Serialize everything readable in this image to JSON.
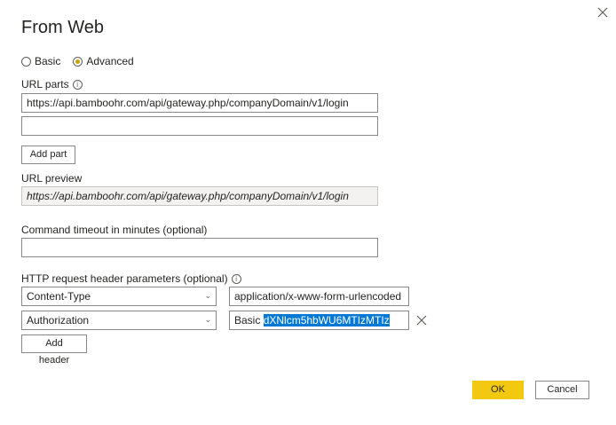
{
  "dialog": {
    "title": "From Web",
    "close_icon": "close-icon"
  },
  "mode": {
    "basic_label": "Basic",
    "advanced_label": "Advanced",
    "selected": "Advanced"
  },
  "url_parts": {
    "label": "URL parts",
    "part1_value": "https://api.bamboohr.com/api/gateway.php/companyDomain/v1/login",
    "part2_value": "",
    "add_part_label": "Add part"
  },
  "url_preview": {
    "label": "URL preview",
    "value": "https://api.bamboohr.com/api/gateway.php/companyDomain/v1/login"
  },
  "timeout": {
    "label": "Command timeout in minutes (optional)",
    "value": ""
  },
  "headers": {
    "label": "HTTP request header parameters (optional)",
    "rows": [
      {
        "name": "Content-Type",
        "value": "application/x-www-form-urlencoded"
      },
      {
        "name": "Authorization",
        "value_prefix": "Basic ",
        "value_selected": "dXNlcm5hbWU6MTIzMTIz"
      }
    ],
    "add_header_label": "Add header"
  },
  "footer": {
    "ok_label": "OK",
    "cancel_label": "Cancel"
  },
  "colors": {
    "accent": "#f2c811",
    "selection": "#0078d4"
  }
}
